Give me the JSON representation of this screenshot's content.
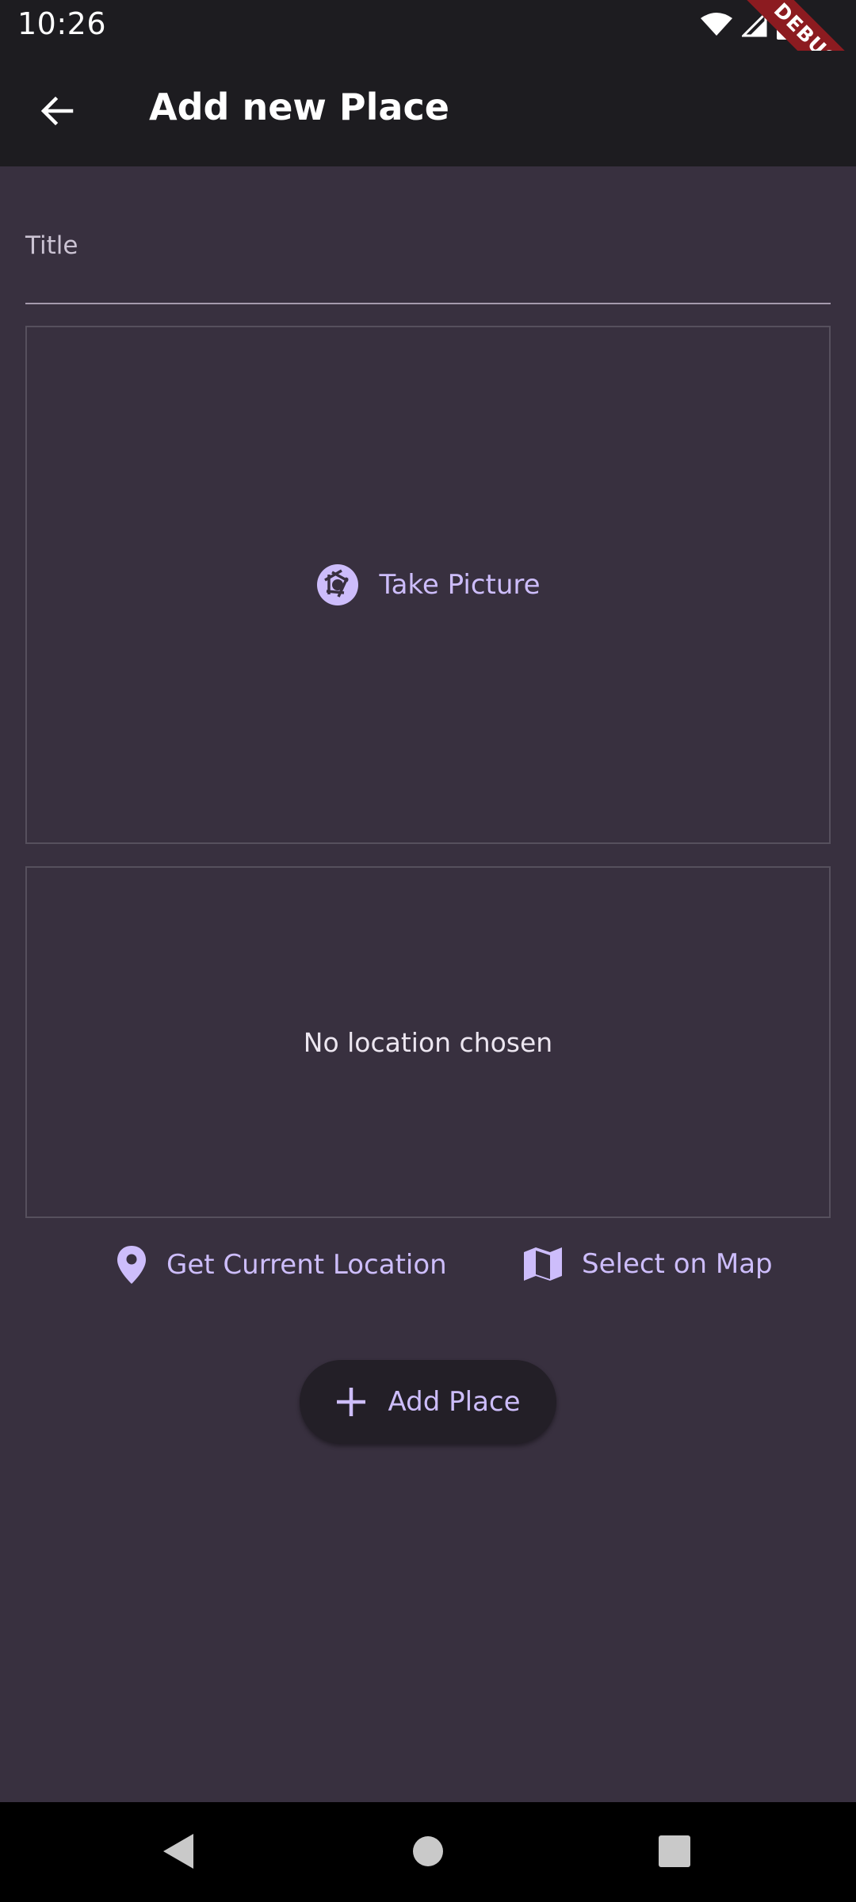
{
  "status_bar": {
    "time": "10:26",
    "debug_label": "DEBUG"
  },
  "app_bar": {
    "title": "Add new Place"
  },
  "form": {
    "title_label": "Title",
    "title_value": "",
    "image_picker": {
      "button_label": "Take Picture"
    },
    "location": {
      "placeholder": "No location chosen",
      "get_current_label": "Get Current Location",
      "select_map_label": "Select on Map"
    },
    "submit_label": "Add Place"
  },
  "icons": {
    "back": "arrow-left-icon",
    "camera": "camera-aperture-icon",
    "location": "location-pin-icon",
    "map": "map-icon",
    "add": "plus-icon"
  },
  "colors": {
    "accent": "#cdbdfb",
    "background": "#38303f",
    "appbar": "#1d1c20",
    "debug": "#8c1b20"
  }
}
